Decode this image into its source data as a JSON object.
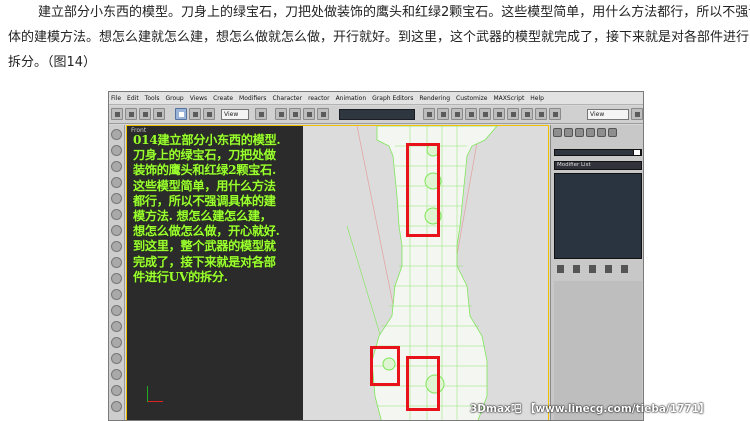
{
  "article": {
    "lines": [
      "建立部分小东西的模型。刀身上的绿宝石，刀把处做装饰的鹰头和红绿2颗宝石。这些模型简单，用什么方法都行，所以不强调具",
      "体的建模方法。想怎么建就怎么建，想怎么做就怎么做，开行就好。到这里，这个武器的模型就完成了，接下来就是对各部件进行UV的",
      "拆分。（图14）"
    ]
  },
  "app": {
    "menu": [
      "File",
      "Edit",
      "Tools",
      "Group",
      "Views",
      "Create",
      "Modifiers",
      "Character",
      "reactor",
      "Animation",
      "Graph Editors",
      "Rendering",
      "Customize",
      "MAXScript",
      "Help"
    ],
    "toolbar": {
      "view_label": "View",
      "view_label_right": "View"
    },
    "viewport": {
      "label": "Front",
      "overlay_lines": [
        "014建立部分小东西的模型.",
        "刀身上的绿宝石，刀把处做",
        "装饰的鹰头和红绿2颗宝石.",
        "这些模型简单，用什么方法",
        "都行，所以不强调具体的建",
        "模方法. 想怎么建怎么建，",
        "想怎么做怎么做，开心就好.",
        "到这里，整个武器的模型就",
        "完成了，接下来就是对各部",
        "件进行UV的拆分."
      ]
    },
    "command_panel": {
      "modifier_list": "Modifier List"
    }
  },
  "watermark": "3Dmax吧 【www.linecg.com/tieba/1771】",
  "colors": {
    "highlight": "#e8121a",
    "overlay_text": "#9bff2f",
    "mesh_wire": "#7fe65a"
  }
}
